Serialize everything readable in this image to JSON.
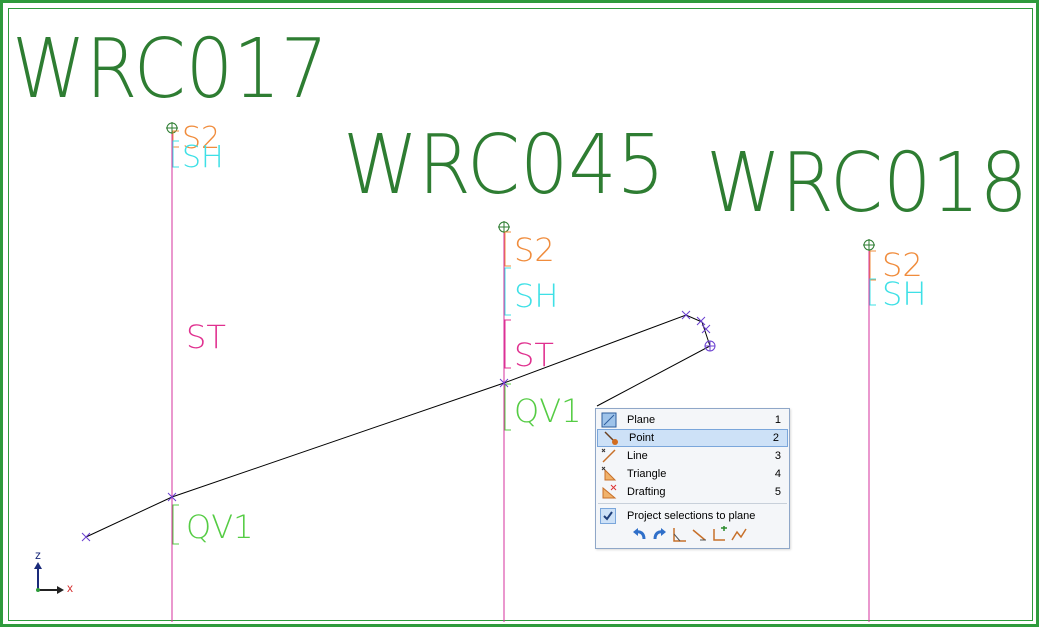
{
  "view": {
    "structure_labels": [
      "WRC017",
      "WRC045",
      "WRC018"
    ],
    "columns": [
      {
        "top_label": "S2",
        "sub_label": "SH",
        "mid_label": "ST",
        "bottom_label": "QV1"
      },
      {
        "top_label": "S2",
        "sub_label": "SH",
        "mid_label": "ST",
        "bottom_label": "QV1"
      },
      {
        "top_label": "S2",
        "sub_label": "SH"
      }
    ],
    "axis": {
      "z_label": "z",
      "x_label": "x"
    },
    "colors": {
      "frame": "#2e9b3c",
      "structure_text": "#2e7d32",
      "s2": "#f08c3c",
      "sh": "#3ee0e6",
      "st": "#e0308f",
      "qv1": "#55cc44",
      "column_line": "#d6309c",
      "sketch_line": "#000000",
      "marker": "#6a3fd0"
    }
  },
  "snap_menu": {
    "items": [
      {
        "label": "Plane",
        "shortcut": "1",
        "icon": "plane-icon"
      },
      {
        "label": "Point",
        "shortcut": "2",
        "icon": "point-icon",
        "selected": true
      },
      {
        "label": "Line",
        "shortcut": "3",
        "icon": "line-icon"
      },
      {
        "label": "Triangle",
        "shortcut": "4",
        "icon": "triangle-icon"
      },
      {
        "label": "Drafting",
        "shortcut": "5",
        "icon": "drafting-icon"
      }
    ],
    "project_option": {
      "label": "Project selections to plane",
      "checked": true
    },
    "toolbar_icons": [
      "undo-icon",
      "redo-icon",
      "angle-snap-icon",
      "perpendicular-icon",
      "add-point-icon",
      "polyline-icon"
    ]
  }
}
